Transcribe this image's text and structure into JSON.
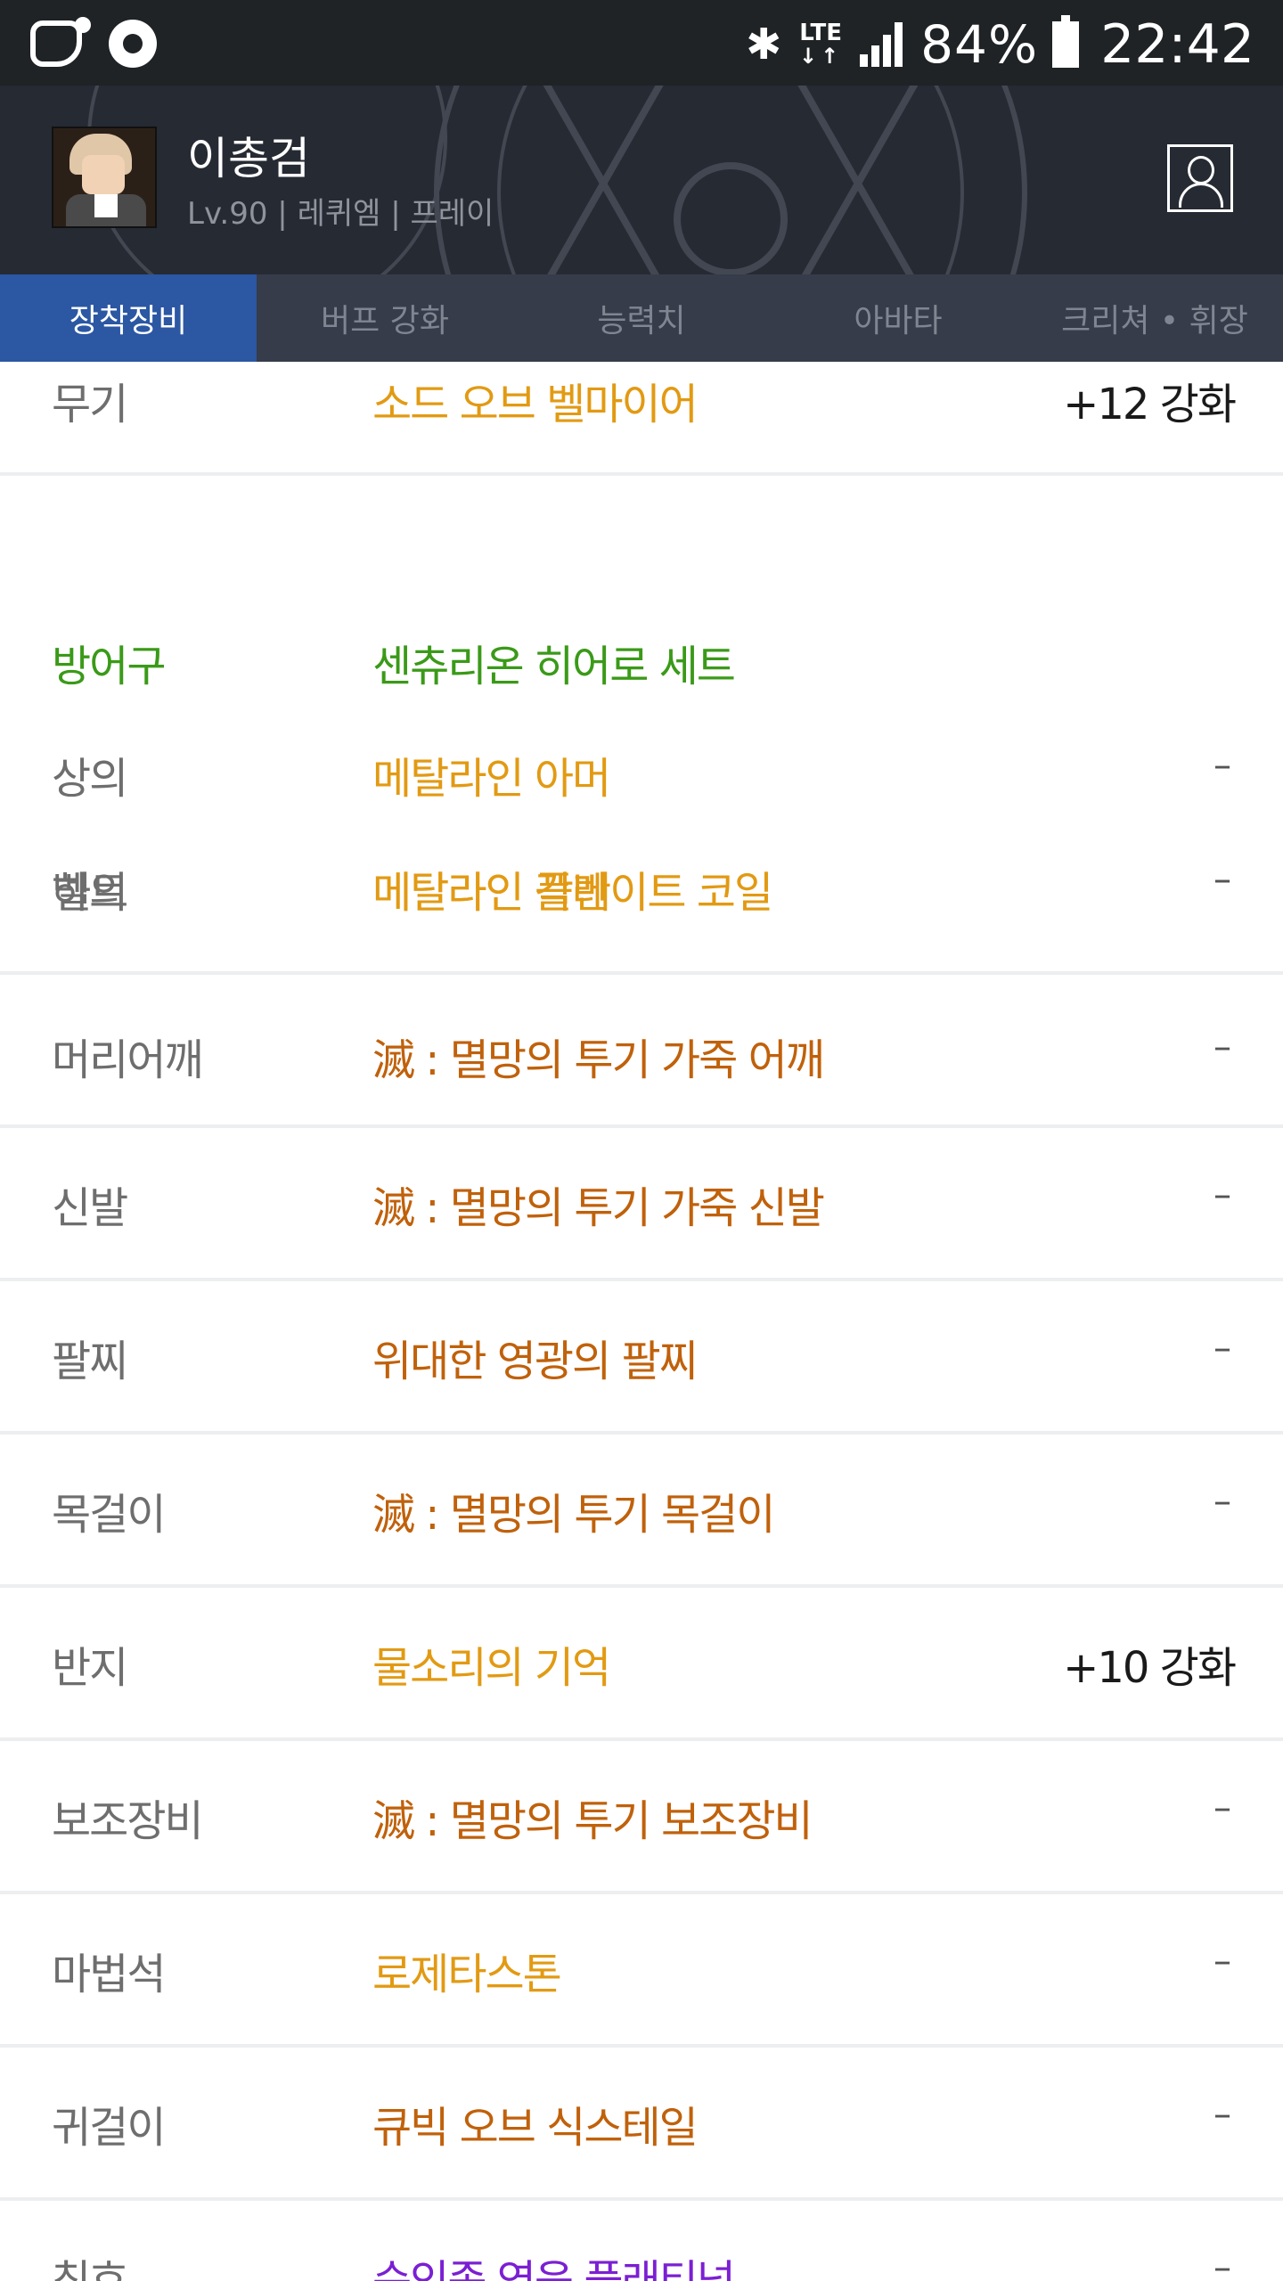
{
  "status_bar": {
    "battery_percent": "84%",
    "time": "22:42",
    "network": "LTE"
  },
  "character": {
    "name": "이총검",
    "meta": "Lv.90 | 레퀴엠 | 프레이"
  },
  "tabs": [
    {
      "label": "장착장비",
      "active": true
    },
    {
      "label": "버프 강화",
      "active": false
    },
    {
      "label": "능력치",
      "active": false
    },
    {
      "label": "아바타",
      "active": false
    },
    {
      "label": "크리쳐 • 휘장",
      "active": false
    }
  ],
  "equipment": {
    "weapon": {
      "slot": "무기",
      "item": "소드 오브 벨마이어",
      "enhance": "+12 강화"
    },
    "armor_set": {
      "slot": "방어구",
      "item": "센츄리온 히어로 세트"
    },
    "top": {
      "slot": "상의",
      "item": "메탈라인 아머",
      "enhance": "–"
    },
    "bottom": {
      "slot": "하의",
      "item": "메탈라인 각반",
      "enhance": "–"
    },
    "belt": {
      "slot": "벨트",
      "item": "메탈라인 플레이트 코일",
      "enhance": "–"
    },
    "shoulder": {
      "slot": "머리어깨",
      "item": "滅 : 멸망의 투기 가죽 어깨",
      "enhance": "–"
    },
    "shoes": {
      "slot": "신발",
      "item": "滅 : 멸망의 투기 가죽 신발",
      "enhance": "–"
    },
    "bracelet": {
      "slot": "팔찌",
      "item": "위대한 영광의 팔찌",
      "enhance": "–"
    },
    "necklace": {
      "slot": "목걸이",
      "item": "滅 : 멸망의 투기 목걸이",
      "enhance": "–"
    },
    "ring": {
      "slot": "반지",
      "item": "물소리의 기억",
      "enhance": "+10 강화"
    },
    "sub": {
      "slot": "보조장비",
      "item": "滅 : 멸망의 투기 보조장비",
      "enhance": "–"
    },
    "magic_stone": {
      "slot": "마법석",
      "item": "로제타스톤",
      "enhance": "–"
    },
    "earring": {
      "slot": "귀걸이",
      "item": "큐빅 오브 식스테일",
      "enhance": "–"
    },
    "title": {
      "slot": "칭호",
      "item": "순인종 영웅 플래티넘",
      "enhance": "–"
    }
  },
  "colors": {
    "tab_active": "#2b57a3",
    "unique": "#e29a13",
    "epic": "#c0610b",
    "set": "#3a9a18",
    "rare": "#7b1fd3"
  }
}
